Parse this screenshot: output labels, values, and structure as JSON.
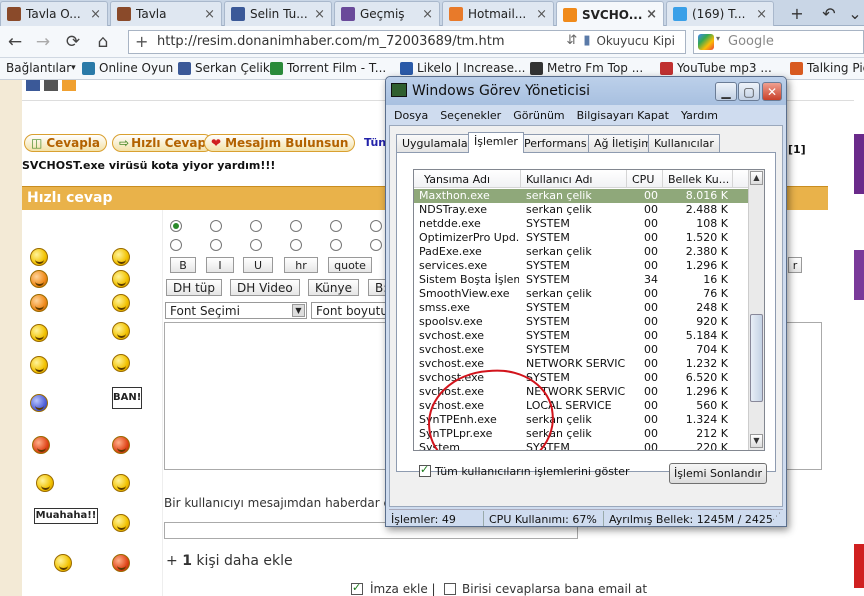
{
  "browser": {
    "tabs": [
      {
        "label": "Tavla O...",
        "icon": "tavla-icon",
        "color": "#8a4a2a"
      },
      {
        "label": "Tavla",
        "icon": "tavla-icon",
        "color": "#8a4a2a"
      },
      {
        "label": "Selin Tu...",
        "icon": "facebook-icon",
        "color": "#3b5998"
      },
      {
        "label": "Geçmiş",
        "icon": "history-icon",
        "color": "#6a4a9a"
      },
      {
        "label": "Hotmail...",
        "icon": "hotmail-icon",
        "color": "#e87a2a"
      },
      {
        "label": "SVCHO...",
        "icon": "donanimhaber-icon",
        "color": "#f08a1a"
      },
      {
        "label": "(169) T...",
        "icon": "twitter-icon",
        "color": "#3aa0e8"
      }
    ],
    "url": "http://resim.donanimhaber.com/m_72003689/tm.htm",
    "reader_label": "Okuyucu Kipi",
    "search_placeholder": "Google",
    "bookmarks": [
      {
        "label": "Bağlantılar",
        "icon": "",
        "color": ""
      },
      {
        "label": "Online Oyun",
        "icon": "puzzle-icon",
        "color": "#2a7aa8"
      },
      {
        "label": "Serkan Çelik",
        "icon": "facebook-icon",
        "color": "#3b5998"
      },
      {
        "label": "Torrent Film - T...",
        "icon": "torrent-icon",
        "color": "#2a8a3a"
      },
      {
        "label": "Likelo | Increase...",
        "icon": "likelo-icon",
        "color": "#2a5aa8"
      },
      {
        "label": "Metro Fm Top ...",
        "icon": "metro-icon",
        "color": "#333"
      },
      {
        "label": "YouTube mp3 ...",
        "icon": "mp3-icon",
        "color": "#c03030"
      },
      {
        "label": "Talking Pie",
        "icon": "balloon-icon",
        "color": "#d85a20"
      }
    ]
  },
  "forum": {
    "buttons": [
      "Cevapla",
      "Hızlı Cevap",
      "Mesajım Bulunsun",
      "Tün"
    ],
    "page_marker": "[1]",
    "topic_title": "SVCHOST.exe virüsü kota yiyor yardım!!!",
    "quick_reply_title": "Hızlı cevap",
    "format_buttons": [
      "B",
      "I",
      "U",
      "hr",
      "quote"
    ],
    "format_btn_right": "r",
    "media_buttons": [
      "DH tüp",
      "DH Video",
      "Künye",
      "B:"
    ],
    "font_select": "Font Seçimi",
    "font_size": "Font boyutu",
    "ban_label": "BAN!",
    "muahaha_label": "Muahaha!!",
    "notify_label": "Bir kullanıcıyı mesajımdan haberdar et",
    "add_person_prefix": "+",
    "add_person_count": "1",
    "add_person_suffix": "kişi daha ekle",
    "signature_label": "İmza ekle |",
    "email_label": "Birisi cevaplarsa bana email at"
  },
  "taskmanager": {
    "title": "Windows Görev Yöneticisi",
    "menu": [
      "Dosya",
      "Seçenekler",
      "Görünüm",
      "Bilgisayarı Kapat",
      "Yardım"
    ],
    "tabs": [
      "Uygulamalar",
      "İşlemler",
      "Performans",
      "Ağ İletişimi",
      "Kullanıcılar"
    ],
    "columns": [
      "Yansıma Adı",
      "Kullanıcı Adı",
      "CPU",
      "Bellek Ku..."
    ],
    "processes": [
      {
        "name": "Maxthon.exe",
        "user": "serkan çelik",
        "cpu": "00",
        "mem": "8.016 K",
        "selected": true
      },
      {
        "name": "NDSTray.exe",
        "user": "serkan çelik",
        "cpu": "00",
        "mem": "2.488 K"
      },
      {
        "name": "netdde.exe",
        "user": "SYSTEM",
        "cpu": "00",
        "mem": "108 K"
      },
      {
        "name": "OptimizerPro Upd...",
        "user": "SYSTEM",
        "cpu": "00",
        "mem": "1.520 K"
      },
      {
        "name": "PadExe.exe",
        "user": "serkan çelik",
        "cpu": "00",
        "mem": "2.380 K"
      },
      {
        "name": "services.exe",
        "user": "SYSTEM",
        "cpu": "00",
        "mem": "1.296 K"
      },
      {
        "name": "Sistem Boşta İşlemi",
        "user": "SYSTEM",
        "cpu": "34",
        "mem": "16 K"
      },
      {
        "name": "SmoothView.exe",
        "user": "serkan çelik",
        "cpu": "00",
        "mem": "76 K"
      },
      {
        "name": "smss.exe",
        "user": "SYSTEM",
        "cpu": "00",
        "mem": "248 K"
      },
      {
        "name": "spoolsv.exe",
        "user": "SYSTEM",
        "cpu": "00",
        "mem": "920 K"
      },
      {
        "name": "svchost.exe",
        "user": "SYSTEM",
        "cpu": "00",
        "mem": "5.184 K"
      },
      {
        "name": "svchost.exe",
        "user": "SYSTEM",
        "cpu": "00",
        "mem": "704 K"
      },
      {
        "name": "svchost.exe",
        "user": "NETWORK SERVICE",
        "cpu": "00",
        "mem": "1.232 K"
      },
      {
        "name": "svchost.exe",
        "user": "SYSTEM",
        "cpu": "00",
        "mem": "6.520 K"
      },
      {
        "name": "svchost.exe",
        "user": "NETWORK SERVICE",
        "cpu": "00",
        "mem": "1.296 K"
      },
      {
        "name": "svchost.exe",
        "user": "LOCAL SERVICE",
        "cpu": "00",
        "mem": "560 K"
      },
      {
        "name": "SynTPEnh.exe",
        "user": "serkan çelik",
        "cpu": "00",
        "mem": "1.324 K"
      },
      {
        "name": "SynTPLpr.exe",
        "user": "serkan çelik",
        "cpu": "00",
        "mem": "212 K"
      },
      {
        "name": "System",
        "user": "SYSTEM",
        "cpu": "00",
        "mem": "220 K"
      }
    ],
    "show_all_label": "Tüm kullanıcıların işlemlerini göster",
    "end_process_label": "İşlemi Sonlandır",
    "status": {
      "processes": "İşlemler: 49",
      "cpu": "CPU Kullanımı: 67%",
      "memory": "Ayrılmış Bellek: 1245M / 2425"
    }
  }
}
